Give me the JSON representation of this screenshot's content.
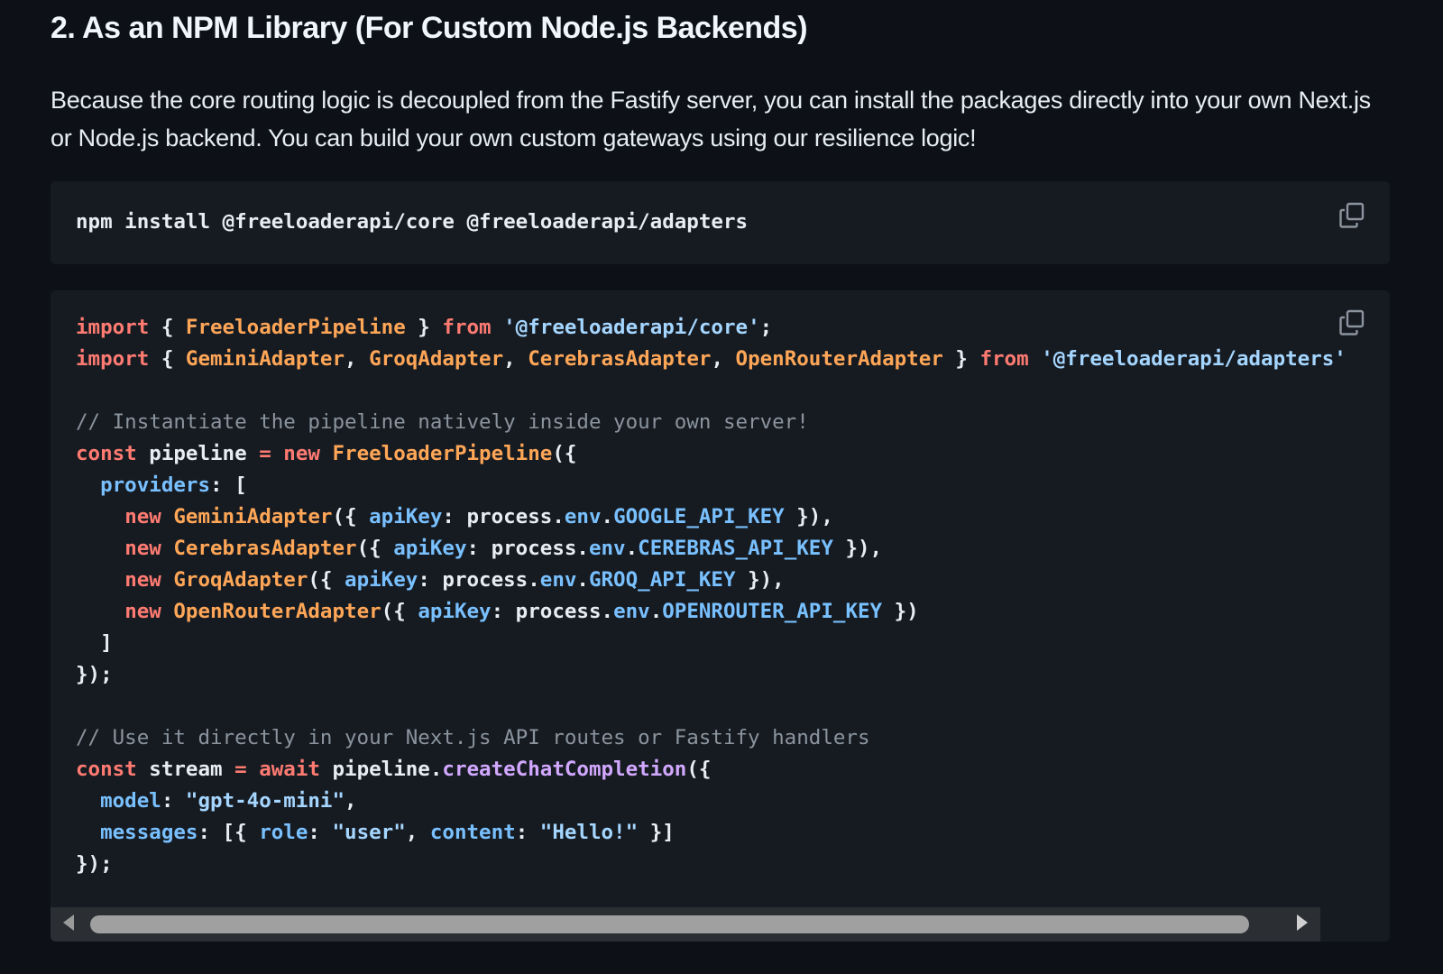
{
  "section": {
    "heading": "2. As an NPM Library (For Custom Node.js Backends)",
    "paragraph": "Because the core routing logic is decoupled from the Fastify server, you can install the packages directly into your own Next.js or Node.js backend. You can build your own custom gateways using our resilience logic!"
  },
  "install_block": {
    "command": "npm install @freeloaderapi/core @freeloaderapi/adapters",
    "copy_icon": "copy-icon"
  },
  "main_block": {
    "copy_icon": "copy-icon",
    "lines": [
      [
        [
          "kw",
          "import"
        ],
        [
          "punc",
          " { "
        ],
        [
          "fn",
          "FreeloaderPipeline"
        ],
        [
          "punc",
          " } "
        ],
        [
          "kw",
          "from"
        ],
        [
          "punc",
          " "
        ],
        [
          "str",
          "'@freeloaderapi/core'"
        ],
        [
          "punc",
          ";"
        ]
      ],
      [
        [
          "kw",
          "import"
        ],
        [
          "punc",
          " { "
        ],
        [
          "fn",
          "GeminiAdapter"
        ],
        [
          "punc",
          ", "
        ],
        [
          "fn",
          "GroqAdapter"
        ],
        [
          "punc",
          ", "
        ],
        [
          "fn",
          "CerebrasAdapter"
        ],
        [
          "punc",
          ", "
        ],
        [
          "fn",
          "OpenRouterAdapter"
        ],
        [
          "punc",
          " } "
        ],
        [
          "kw",
          "from"
        ],
        [
          "punc",
          " "
        ],
        [
          "str",
          "'@freeloaderapi/adapters'"
        ]
      ],
      [],
      [
        [
          "comment",
          "// Instantiate the pipeline natively inside your own server!"
        ]
      ],
      [
        [
          "kw",
          "const"
        ],
        [
          "punc",
          " pipeline "
        ],
        [
          "kw",
          "="
        ],
        [
          "punc",
          " "
        ],
        [
          "kw",
          "new"
        ],
        [
          "punc",
          " "
        ],
        [
          "fn",
          "FreeloaderPipeline"
        ],
        [
          "punc",
          "({"
        ]
      ],
      [
        [
          "punc",
          "  "
        ],
        [
          "prop",
          "providers"
        ],
        [
          "punc",
          ": ["
        ]
      ],
      [
        [
          "punc",
          "    "
        ],
        [
          "kw",
          "new"
        ],
        [
          "punc",
          " "
        ],
        [
          "fn",
          "GeminiAdapter"
        ],
        [
          "punc",
          "({ "
        ],
        [
          "prop",
          "apiKey"
        ],
        [
          "punc",
          ": process."
        ],
        [
          "prop",
          "env"
        ],
        [
          "punc",
          "."
        ],
        [
          "prop",
          "GOOGLE_API_KEY"
        ],
        [
          "punc",
          " }),"
        ]
      ],
      [
        [
          "punc",
          "    "
        ],
        [
          "kw",
          "new"
        ],
        [
          "punc",
          " "
        ],
        [
          "fn",
          "CerebrasAdapter"
        ],
        [
          "punc",
          "({ "
        ],
        [
          "prop",
          "apiKey"
        ],
        [
          "punc",
          ": process."
        ],
        [
          "prop",
          "env"
        ],
        [
          "punc",
          "."
        ],
        [
          "prop",
          "CEREBRAS_API_KEY"
        ],
        [
          "punc",
          " }),"
        ]
      ],
      [
        [
          "punc",
          "    "
        ],
        [
          "kw",
          "new"
        ],
        [
          "punc",
          " "
        ],
        [
          "fn",
          "GroqAdapter"
        ],
        [
          "punc",
          "({ "
        ],
        [
          "prop",
          "apiKey"
        ],
        [
          "punc",
          ": process."
        ],
        [
          "prop",
          "env"
        ],
        [
          "punc",
          "."
        ],
        [
          "prop",
          "GROQ_API_KEY"
        ],
        [
          "punc",
          " }),"
        ]
      ],
      [
        [
          "punc",
          "    "
        ],
        [
          "kw",
          "new"
        ],
        [
          "punc",
          " "
        ],
        [
          "fn",
          "OpenRouterAdapter"
        ],
        [
          "punc",
          "({ "
        ],
        [
          "prop",
          "apiKey"
        ],
        [
          "punc",
          ": process."
        ],
        [
          "prop",
          "env"
        ],
        [
          "punc",
          "."
        ],
        [
          "prop",
          "OPENROUTER_API_KEY"
        ],
        [
          "punc",
          " })"
        ]
      ],
      [
        [
          "punc",
          "  ]"
        ]
      ],
      [
        [
          "punc",
          "});"
        ]
      ],
      [],
      [
        [
          "comment",
          "// Use it directly in your Next.js API routes or Fastify handlers"
        ]
      ],
      [
        [
          "kw",
          "const"
        ],
        [
          "punc",
          " stream "
        ],
        [
          "kw",
          "="
        ],
        [
          "punc",
          " "
        ],
        [
          "kw",
          "await"
        ],
        [
          "punc",
          " pipeline."
        ],
        [
          "method",
          "createChatCompletion"
        ],
        [
          "punc",
          "({"
        ]
      ],
      [
        [
          "punc",
          "  "
        ],
        [
          "prop",
          "model"
        ],
        [
          "punc",
          ": "
        ],
        [
          "str",
          "\"gpt-4o-mini\""
        ],
        [
          "punc",
          ","
        ]
      ],
      [
        [
          "punc",
          "  "
        ],
        [
          "prop",
          "messages"
        ],
        [
          "punc",
          ": [{ "
        ],
        [
          "prop",
          "role"
        ],
        [
          "punc",
          ": "
        ],
        [
          "str",
          "\"user\""
        ],
        [
          "punc",
          ", "
        ],
        [
          "prop",
          "content"
        ],
        [
          "punc",
          ": "
        ],
        [
          "str",
          "\"Hello!\""
        ],
        [
          "punc",
          " }]"
        ]
      ],
      [
        [
          "punc",
          "});"
        ]
      ]
    ]
  },
  "scrollbar": {
    "left_arrow_icon": "left-arrow-icon",
    "right_arrow_icon": "right-arrow-icon",
    "thumb_fraction": 0.91
  },
  "colors": {
    "background": "#0d1117",
    "code_background": "#161b22",
    "keyword": "#ff7b72",
    "function": "#ffa657",
    "string": "#a5d6ff",
    "property": "#79c0ff",
    "method": "#d2a8ff",
    "comment": "#8b949e"
  }
}
